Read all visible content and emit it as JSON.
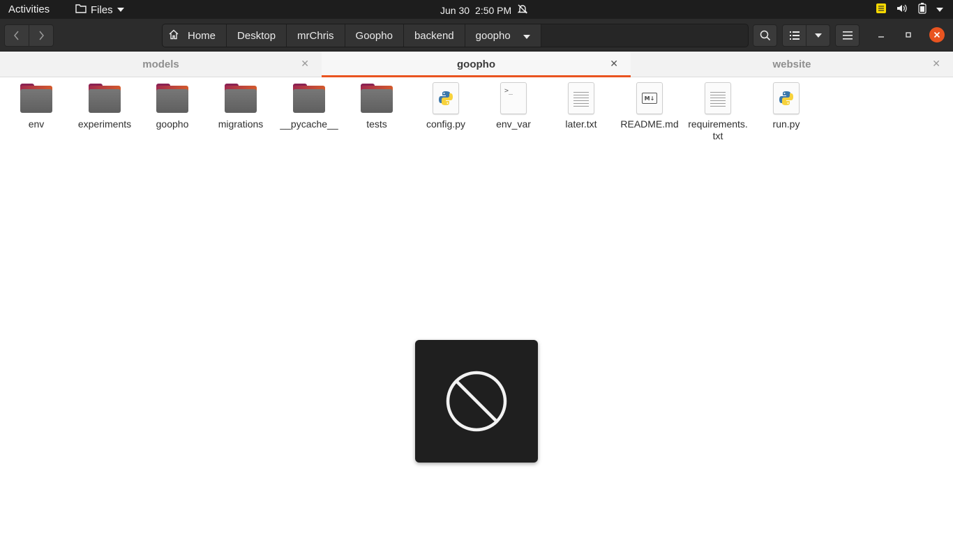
{
  "topbar": {
    "activities": "Activities",
    "app_name": "Files",
    "date": "Jun 30",
    "time": "2:50 PM"
  },
  "pathbar": {
    "crumbs": [
      "Home",
      "Desktop",
      "mrChris",
      "Goopho",
      "backend",
      "goopho"
    ]
  },
  "tabs": [
    {
      "label": "models",
      "active": false
    },
    {
      "label": "goopho",
      "active": true
    },
    {
      "label": "website",
      "active": false
    }
  ],
  "files": [
    {
      "name": "env",
      "type": "folder"
    },
    {
      "name": "experiments",
      "type": "folder"
    },
    {
      "name": "goopho",
      "type": "folder"
    },
    {
      "name": "migrations",
      "type": "folder"
    },
    {
      "name": "__pycache__",
      "type": "folder"
    },
    {
      "name": "tests",
      "type": "folder"
    },
    {
      "name": "config.py",
      "type": "python"
    },
    {
      "name": "env_var",
      "type": "script"
    },
    {
      "name": "later.txt",
      "type": "text"
    },
    {
      "name": "README.md",
      "type": "markdown"
    },
    {
      "name": "requirements.txt",
      "type": "text"
    },
    {
      "name": "run.py",
      "type": "python"
    }
  ],
  "icons": {
    "md_badge": "M↓",
    "term_prompt": ">_"
  },
  "colors": {
    "accent": "#e95420",
    "topbar_bg": "#1d1d1d",
    "headerbar_bg": "#2c2c2c"
  }
}
